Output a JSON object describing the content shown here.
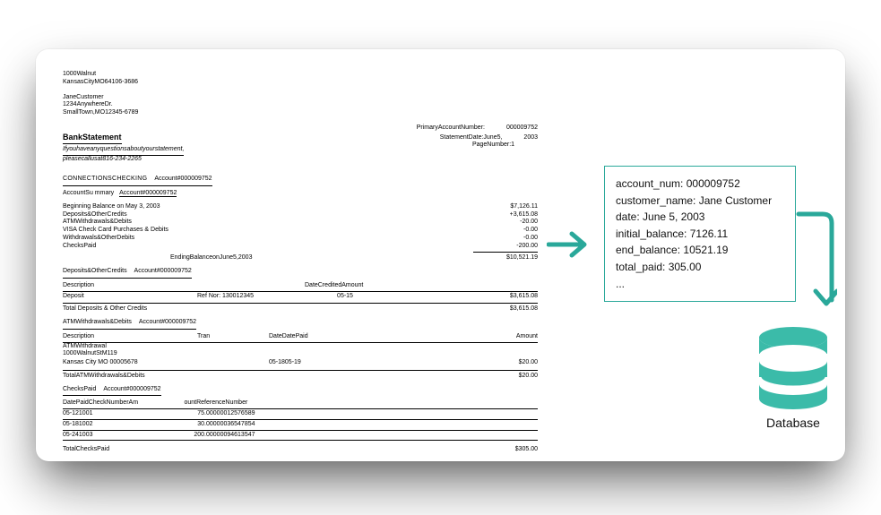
{
  "statement": {
    "bank_addr1": "1000Walnut",
    "bank_addr2": "KansasCityMO64106-3686",
    "cust_name": "JaneCustomer",
    "cust_addr1": "1234AnywhereDr.",
    "cust_addr2": "SmallTown,MO12345-6789",
    "primary_acct_label": "PrimaryAccountNumber:",
    "primary_acct_value": "000009752",
    "title": "BankStatement",
    "stmt_date_label": "StatementDate:June5,",
    "stmt_date_year": "2003",
    "page_label": "PageNumber:1",
    "help_line1": "Ifyouhaveanyquestionsaboutyourstatement,",
    "help_line2": "pleasecallusat816-234-2265",
    "section_conn": "CONNECTIONSCHECKING",
    "conn_acct": "Account#000009752",
    "acct_summary": "AccountSu mmary",
    "acct_summary_acct": "Account#000009752",
    "summary": {
      "begin_label": "Beginning Balance on May 3, 2003",
      "begin_val": "$7,126.11",
      "depcr_label": "Deposits&OtherCredits",
      "depcr_val": "+3,615.08",
      "atm_label": "ATMWithdrawals&Debits",
      "atm_val": "-20.00",
      "visa_label": "VISA Check Card Purchases & Debits",
      "visa_val": "-0.00",
      "wod_label": "Withdrawals&OtherDebits",
      "wod_val": "-0.00",
      "checks_label": "ChecksPaid",
      "checks_val": "-200.00",
      "end_label": "EndingBalanceonJune5,2003",
      "end_val": "$10,521.19"
    },
    "dep_section": "Deposits&OtherCredits",
    "dep_acct": "Account#000009752",
    "dep_head_desc": "Description",
    "dep_head_date": "DateCreditedAmount",
    "dep_row": {
      "desc": "Deposit",
      "ref": "Ref Nor:    130012345",
      "date": "05-15",
      "amt": "$3,615.08"
    },
    "dep_total_label": "Total Deposits & Other Credits",
    "dep_total_val": "$3,615.08",
    "atm_section": "ATMWithdrawals&Debits",
    "atm_acct": "Account#000009752",
    "atm_head_desc": "Description",
    "atm_head_tran": "Tran",
    "atm_head_date": "DateDatePaid",
    "atm_head_amt": "Amount",
    "atm_rows": {
      "r1": "ATMWithdrawal",
      "r2": "1000WalnutStM119",
      "r3a": "Kansas City MO    00005678",
      "r3b": "05-1805-19",
      "r3c": "$20.00"
    },
    "atm_total_label": "TotalATMWithdrawals&Debits",
    "atm_total_val": "$20.00",
    "chk_section": "ChecksPaid",
    "chk_acct": "Account#000009752",
    "chk_head1": "DatePaidCheckNumberAm",
    "chk_head2": "ountRef",
    "chk_head3": "erenceNumber",
    "chk_rows": [
      {
        "c1": "05-121001",
        "c2": "75.",
        "c3": "00000012576589"
      },
      {
        "c1": "05-181002",
        "c2": "30.",
        "c3": "00000036547854"
      },
      {
        "c1": "05-241003",
        "c2": "200.",
        "c3": "00000094613547"
      }
    ],
    "chk_total_label": "TotalChecksPaid",
    "chk_total_val": "$305.00"
  },
  "extract": {
    "account_num": "account_num: 000009752",
    "customer_name": "customer_name: Jane Customer",
    "date": "date: June 5, 2003",
    "initial_balance": "initial_balance: 7126.11",
    "end_balance": "end_balance: 10521.19",
    "total_paid": "total_paid: 305.00",
    "ellipsis": "..."
  },
  "db_label": "Database",
  "colors": {
    "teal": "#2aa89a"
  }
}
